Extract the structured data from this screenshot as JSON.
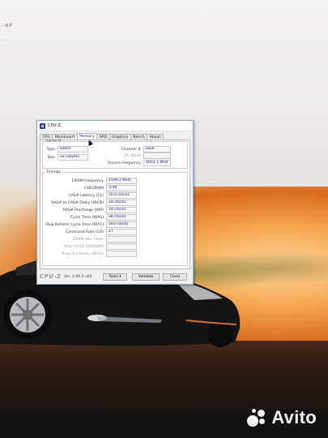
{
  "desktop": {
    "icon_label_a": "...g.jr",
    "icon_label_b": "..."
  },
  "window": {
    "title": "CPU-Z",
    "tabs": [
      "CPU",
      "Mainboard",
      "Memory",
      "SPD",
      "Graphics",
      "Bench",
      "About"
    ],
    "active_tab": "Memory",
    "general": {
      "legend": "General",
      "type_label": "Type",
      "type_value": "DDR4",
      "size_label": "Size",
      "size_value": "32 GBytes",
      "channel_label": "Channel #",
      "channel_value": "Dual",
      "dc_mode_label": "DC Mode",
      "uncore_label": "Uncore Frequency",
      "uncore_value": "4002.1 MHz"
    },
    "timings": {
      "legend": "Timings",
      "rows": [
        {
          "label": "DRAM Frequency",
          "value": "1599.2 MHz"
        },
        {
          "label": "FSB:DRAM",
          "value": "3:48"
        },
        {
          "label": "CAS# Latency (CL)",
          "value": "16.0 clocks"
        },
        {
          "label": "RAS# to CAS# Delay (tRCD)",
          "value": "18 clocks"
        },
        {
          "label": "RAS# Precharge (tRP)",
          "value": "18 clocks"
        },
        {
          "label": "Cycle Time (tRAS)",
          "value": "38 clocks"
        },
        {
          "label": "Row Refresh Cycle Time (tRFC)",
          "value": "560 clocks"
        },
        {
          "label": "Command Rate (CR)",
          "value": "2T"
        },
        {
          "label": "DRAM Idle Timer",
          "value": ""
        },
        {
          "label": "Total CAS# (tRDRAM)",
          "value": ""
        },
        {
          "label": "Row To Column (tRCD)",
          "value": ""
        }
      ]
    },
    "footer": {
      "brand": "CPU-Z",
      "version": "Ver. 2.09.0.x64",
      "tools_label": "Tools",
      "validate_label": "Validate",
      "close_label": "Close"
    }
  },
  "watermark": {
    "text": "Avito"
  }
}
